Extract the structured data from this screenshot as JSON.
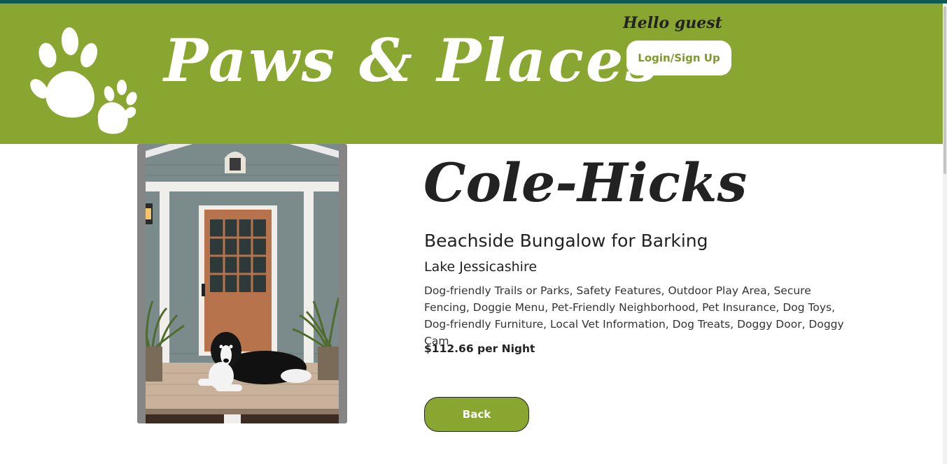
{
  "header": {
    "brand": "Paws & Places",
    "greeting": "Hello guest",
    "login_label": "Login/Sign Up"
  },
  "listing": {
    "owner": "Cole-Hicks",
    "title": "Beachside Bungalow for Barking",
    "location": "Lake Jessicashire",
    "amenities": "Dog-friendly Trails or Parks, Safety Features, Outdoor Play Area, Secure Fencing, Doggie Menu, Pet-Friendly Neighborhood, Pet Insurance, Dog Toys, Dog-friendly Furniture, Local Vet Information, Dog Treats, Doggy Door, Doggy Cam",
    "price": "$112.66 per Night",
    "back_label": "Back"
  },
  "colors": {
    "header_bg": "#88a630",
    "accent_text": "#7e9a2b",
    "top_strip": "#0d5a55"
  },
  "icons": {
    "logo": "paw-prints-icon"
  }
}
